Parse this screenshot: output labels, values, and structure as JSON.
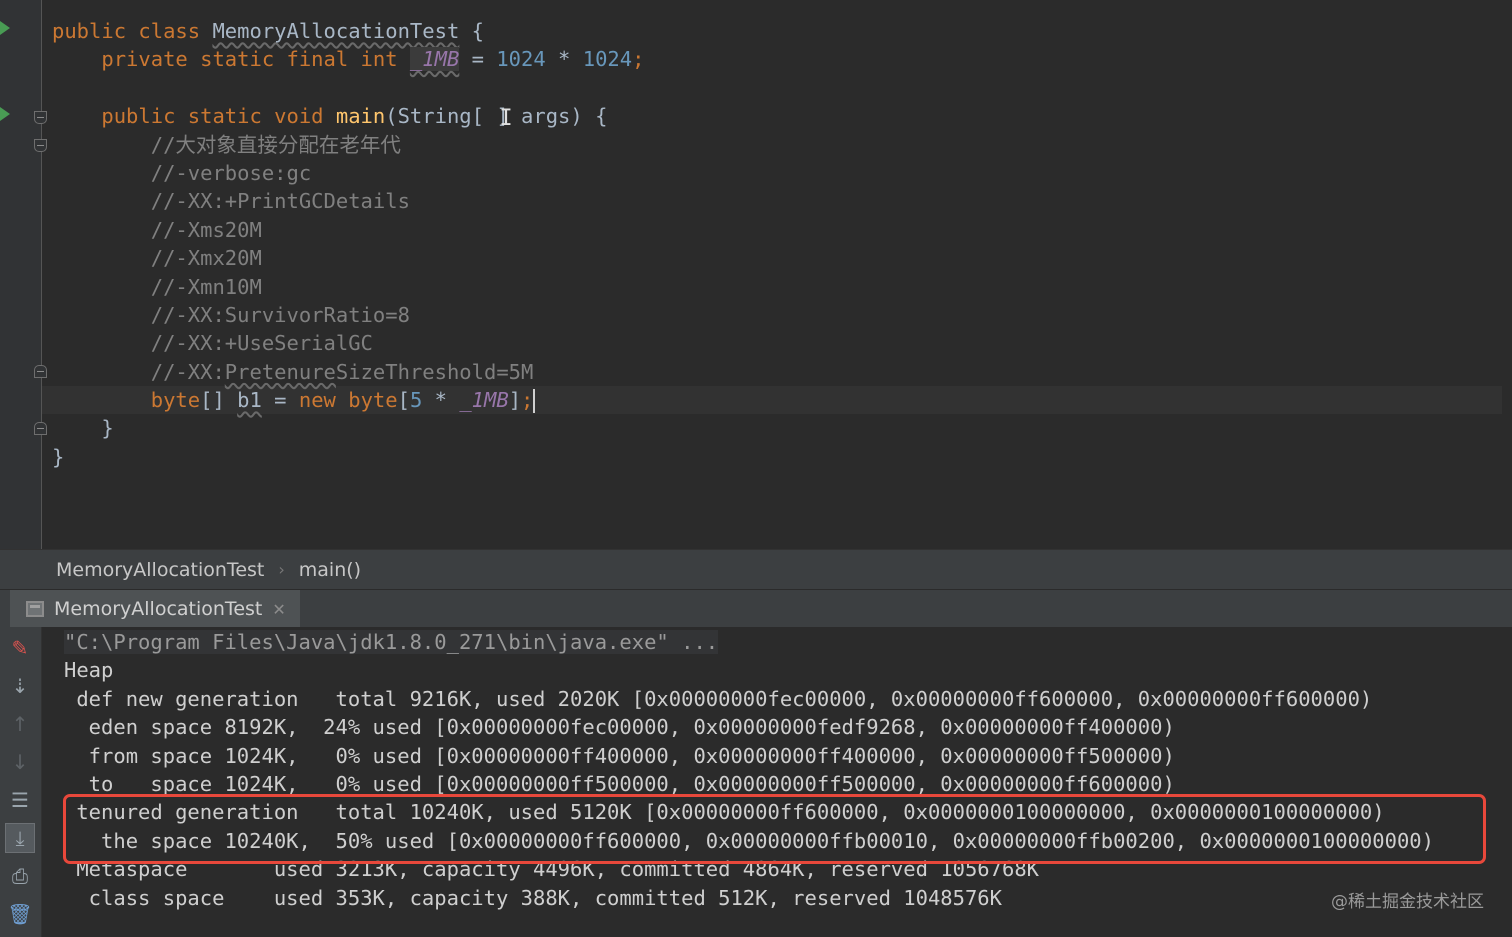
{
  "editor": {
    "code_lines": [
      {
        "id": 1,
        "tokens": [
          {
            "t": "public class ",
            "c": "kw"
          },
          {
            "t": "MemoryAllocationTest",
            "c": "sq"
          },
          {
            "t": " {",
            "c": ""
          }
        ]
      },
      {
        "id": 2,
        "tokens": [
          {
            "t": "    private static final int ",
            "c": "kw"
          },
          {
            "t": "_1MB",
            "c": "fld fld-hl sq"
          },
          {
            "t": " = ",
            "c": ""
          },
          {
            "t": "1024",
            "c": "num"
          },
          {
            "t": " * ",
            "c": ""
          },
          {
            "t": "1024",
            "c": "num"
          },
          {
            "t": ";",
            "c": "kw"
          }
        ]
      },
      {
        "id": 3,
        "tokens": []
      },
      {
        "id": 4,
        "tokens": [
          {
            "t": "    public static void ",
            "c": "kw"
          },
          {
            "t": "main",
            "c": "mtd"
          },
          {
            "t": "(String[ ] args) {",
            "c": ""
          }
        ]
      },
      {
        "id": 5,
        "tokens": [
          {
            "t": "        //大对象直接分配在老年代",
            "c": "cmt"
          }
        ]
      },
      {
        "id": 6,
        "tokens": [
          {
            "t": "        //-verbose:gc",
            "c": "cmt"
          }
        ]
      },
      {
        "id": 7,
        "tokens": [
          {
            "t": "        //-XX:+PrintGCDetails",
            "c": "cmt"
          }
        ]
      },
      {
        "id": 8,
        "tokens": [
          {
            "t": "        //-Xms20M",
            "c": "cmt"
          }
        ]
      },
      {
        "id": 9,
        "tokens": [
          {
            "t": "        //-Xmx20M",
            "c": "cmt"
          }
        ]
      },
      {
        "id": 10,
        "tokens": [
          {
            "t": "        //-Xmn10M",
            "c": "cmt"
          }
        ]
      },
      {
        "id": 11,
        "tokens": [
          {
            "t": "        //-XX:SurvivorRatio=8",
            "c": "cmt"
          }
        ]
      },
      {
        "id": 12,
        "tokens": [
          {
            "t": "        //-XX:+UseSerialGC",
            "c": "cmt"
          }
        ]
      },
      {
        "id": 13,
        "tokens": [
          {
            "t": "        //-XX:",
            "c": "cmt"
          },
          {
            "t": "Pretenure",
            "c": "cmt sq"
          },
          {
            "t": "SizeThreshold=5M",
            "c": "cmt"
          }
        ]
      },
      {
        "id": 14,
        "current": true,
        "tokens": [
          {
            "t": "        byte",
            "c": "kw"
          },
          {
            "t": "[] ",
            "c": ""
          },
          {
            "t": "b1",
            "c": "sq"
          },
          {
            "t": " = ",
            "c": ""
          },
          {
            "t": "new byte",
            "c": "kw"
          },
          {
            "t": "[",
            "c": ""
          },
          {
            "t": "5",
            "c": "num"
          },
          {
            "t": " * ",
            "c": ""
          },
          {
            "t": "_1MB",
            "c": "fld"
          },
          {
            "t": "]",
            "c": ""
          },
          {
            "t": ";",
            "c": "kw"
          }
        ]
      },
      {
        "id": 15,
        "tokens": [
          {
            "t": "    }",
            "c": ""
          }
        ]
      },
      {
        "id": 16,
        "tokens": [
          {
            "t": "}",
            "c": ""
          }
        ]
      }
    ]
  },
  "breadcrumb": {
    "class_name": "MemoryAllocationTest",
    "method_name": "main()"
  },
  "run_tab": {
    "label": "MemoryAllocationTest"
  },
  "console": {
    "lines": [
      "\"C:\\Program Files\\Java\\jdk1.8.0_271\\bin\\java.exe\" ...",
      "Heap",
      " def new generation   total 9216K, used 2020K [0x00000000fec00000, 0x00000000ff600000, 0x00000000ff600000)",
      "  eden space 8192K,  24% used [0x00000000fec00000, 0x00000000fedf9268, 0x00000000ff400000)",
      "  from space 1024K,   0% used [0x00000000ff400000, 0x00000000ff400000, 0x00000000ff500000)",
      "  to   space 1024K,   0% used [0x00000000ff500000, 0x00000000ff500000, 0x00000000ff600000)",
      " tenured generation   total 10240K, used 5120K [0x00000000ff600000, 0x0000000100000000, 0x0000000100000000)",
      "   the space 10240K,  50% used [0x00000000ff600000, 0x00000000ffb00010, 0x00000000ffb00200, 0x0000000100000000)",
      " Metaspace       used 3213K, capacity 4496K, committed 4864K, reserved 1056768K",
      "  class space    used 353K, capacity 388K, committed 512K, reserved 1048576K"
    ]
  },
  "toolstrip": {
    "icons": [
      "pencil-icon",
      "sort-down-icon",
      "arrow-up-icon",
      "arrow-down-icon",
      "soft-wrap-icon",
      "scroll-to-end-icon",
      "print-icon",
      "trash-icon"
    ]
  },
  "watermark": {
    "text": "@稀土掘金技术社区"
  },
  "colors": {
    "highlight_box": "#e8483b",
    "keyword": "#cc7832",
    "number": "#6897bb",
    "comment": "#808080",
    "field": "#9876aa",
    "method": "#ffc66d"
  }
}
